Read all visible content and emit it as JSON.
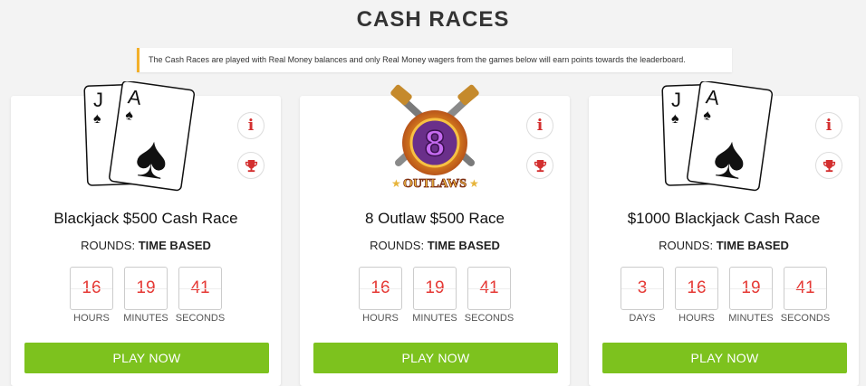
{
  "page": {
    "title": "CASH RACES",
    "notice": "The Cash Races are played with Real Money balances and only Real Money wagers from the games below will earn points towards the leaderboard."
  },
  "colors": {
    "accent_red": "#e53935",
    "play_green": "#7dc21e",
    "notice_border": "#f3b02a"
  },
  "cards": [
    {
      "image": "blackjack-cards",
      "card_letters": [
        "J",
        "A"
      ],
      "name": "Blackjack $500 Cash Race",
      "rounds_label": "ROUNDS:",
      "rounds_value": "TIME BASED",
      "timer": [
        {
          "value": "16",
          "label": "HOURS"
        },
        {
          "value": "19",
          "label": "MINUTES"
        },
        {
          "value": "41",
          "label": "SECONDS"
        }
      ],
      "play_label": "PLAY NOW"
    },
    {
      "image": "8-outlaws-logo",
      "logo_number": "8",
      "logo_text": "OUTLAWS",
      "name": "8 Outlaw $500 Race",
      "rounds_label": "ROUNDS:",
      "rounds_value": "TIME BASED",
      "timer": [
        {
          "value": "16",
          "label": "HOURS"
        },
        {
          "value": "19",
          "label": "MINUTES"
        },
        {
          "value": "41",
          "label": "SECONDS"
        }
      ],
      "play_label": "PLAY NOW"
    },
    {
      "image": "blackjack-cards",
      "card_letters": [
        "J",
        "A"
      ],
      "name": "$1000 Blackjack Cash Race",
      "rounds_label": "ROUNDS:",
      "rounds_value": "TIME BASED",
      "timer": [
        {
          "value": "3",
          "label": "DAYS"
        },
        {
          "value": "16",
          "label": "HOURS"
        },
        {
          "value": "19",
          "label": "MINUTES"
        },
        {
          "value": "41",
          "label": "SECONDS"
        }
      ],
      "play_label": "PLAY NOW"
    }
  ],
  "icons": {
    "info": "info-icon",
    "trophy": "trophy-icon"
  }
}
